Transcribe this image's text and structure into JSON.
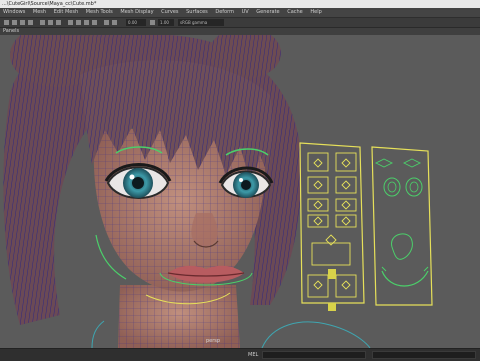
{
  "window": {
    "title": "...\\CuteGirl\\Source\\Maya_cc\\Cute.mb*"
  },
  "menubar": {
    "items": [
      "Windows",
      "Mesh",
      "Edit Mesh",
      "Mesh Tools",
      "Mesh Display",
      "Curves",
      "Surfaces",
      "Deform",
      "UV",
      "Generate",
      "Cache",
      "Help"
    ]
  },
  "toolbar": {
    "field_left": "0.00",
    "field_right": "1.00",
    "colorspace": "sRGB gamma"
  },
  "panel": {
    "menu_label": "Panels"
  },
  "viewport": {
    "camera_label": "persp"
  },
  "statusbar": {
    "label": "MEL"
  },
  "colors": {
    "wire_blue": "#2a2a9a",
    "skin": "#b07a6c",
    "control_yellow": "#e6e05a",
    "control_green": "#4bcf6a",
    "eye_teal": "#3fa5b0"
  }
}
